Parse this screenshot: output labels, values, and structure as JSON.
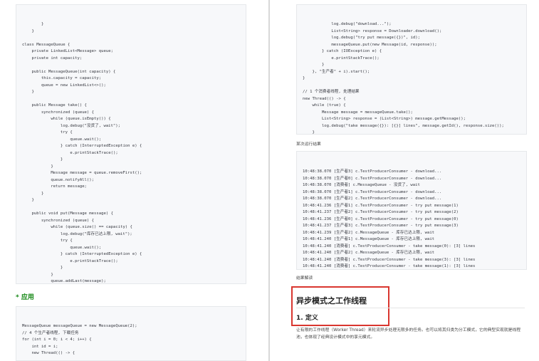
{
  "left": {
    "code_top": [
      "        }",
      "    }",
      "",
      "class MessageQueue {",
      "    private LinkedList<Message> queue;",
      "    private int capacity;",
      "",
      "    public MessageQueue(int capacity) {",
      "        this.capacity = capacity;",
      "        queue = new LinkedList<>();",
      "    }",
      "",
      "    public Message take() {",
      "        synchronized (queue) {",
      "            while (queue.isEmpty()) {",
      "                log.debug(\"没货了, wait\");",
      "                try {",
      "                    queue.wait();",
      "                } catch (InterruptedException e) {",
      "                    e.printStackTrace();",
      "                }",
      "            }",
      "            Message message = queue.removeFirst();",
      "            queue.notifyAll();",
      "            return message;",
      "        }",
      "    }",
      "",
      "    public void put(Message message) {",
      "        synchronized (queue) {",
      "            while (queue.size() == capacity) {",
      "                log.debug(\"库存已达上限, wait\");",
      "                try {",
      "                    queue.wait();",
      "                } catch (InterruptedException e) {",
      "                    e.printStackTrace();",
      "                }",
      "            }",
      "            queue.addLast(message);",
      "            queue.notifyAll();",
      "        }",
      "    }",
      "}"
    ],
    "heading_apply": "* 应用",
    "code_bottom": [
      "MessageQueue messageQueue = new MessageQueue(2);",
      "// 4 个生产者线程, 下载任务",
      "for (int i = 0; i < 4; i++) {",
      "    int id = i;",
      "    new Thread(() -> {",
      "",
      "        try {"
    ]
  },
  "right": {
    "code_top": [
      "            log.debug(\"download...\");",
      "            List<String> response = Downloader.download();",
      "            log.debug(\"try put message({})\", id);",
      "            messageQueue.put(new Message(id, response));",
      "        } catch (IOException e) {",
      "            e.printStackTrace();",
      "        }",
      "    }, \"生产者\" + i).start();",
      "}",
      "",
      "// 1 个消费者线程, 处理结果",
      "new Thread(() -> {",
      "    while (true) {",
      "        Message message = messageQueue.take();",
      "        List<String> response = (List<String>) message.getMessage();",
      "        log.debug(\"take message({}): [{}] lines\", message.getId(), response.size());",
      "    }",
      "",
      "}, \"消费者\").start();"
    ],
    "run_result_label": "某次运行结果",
    "output": [
      "10:48:38.070 [生产者3] c.TestProducerConsumer - download...",
      "10:48:38.070 [生产者0] c.TestProducerConsumer - download...",
      "10:48:38.070 [消费者] c.MessageQueue - 没货了, wait",
      "10:48:38.070 [生产者1] c.TestProducerConsumer - download...",
      "10:48:38.070 [生产者2] c.TestProducerConsumer - download...",
      "10:48:41.236 [生产者1] c.TestProducerConsumer - try put message(1)",
      "10:48:41.237 [生产者2] c.TestProducerConsumer - try put message(2)",
      "10:48:41.236 [生产者0] c.TestProducerConsumer - try put message(0)",
      "10:48:41.237 [生产者3] c.TestProducerConsumer - try put message(3)",
      "10:48:41.239 [生产者2] c.MessageQueue - 库存已达上限, wait",
      "10:48:41.240 [生产者1] c.MessageQueue - 库存已达上限, wait",
      "10:48:41.240 [消费者] c.TestProducerConsumer - take message(0): [3] lines",
      "10:48:41.240 [生产者2] c.MessageQueue - 库存已达上限, wait",
      "10:48:41.240 [消费者] c.TestProducerConsumer - take message(3): [3] lines",
      "10:48:41.240 [消费者] c.TestProducerConsumer - take message(1): [3] lines",
      "10:48:41.240 [消费者] c.TestProducerConsumer - take message(2): [3] lines",
      "10:48:41.240 [消费者] c.MessageQueue - 没货了, wait"
    ],
    "result_explain_label": "结果解读",
    "heading_async": "异步模式之工作线程",
    "heading_definition": "1. 定义",
    "paragraph": "让有限的工作线程（Worker Thread）来轮流异步处理无限多的任务。也可以将其归类为分工模式，它的典型实现就是线程池，也体现了经典设计模式中的享元模式。"
  },
  "colors": {
    "accent_red": "#d9362f",
    "heading_green": "#1a8a1a",
    "keyword": "#a626a4",
    "string": "#c0392b",
    "comment": "#e67e22"
  }
}
